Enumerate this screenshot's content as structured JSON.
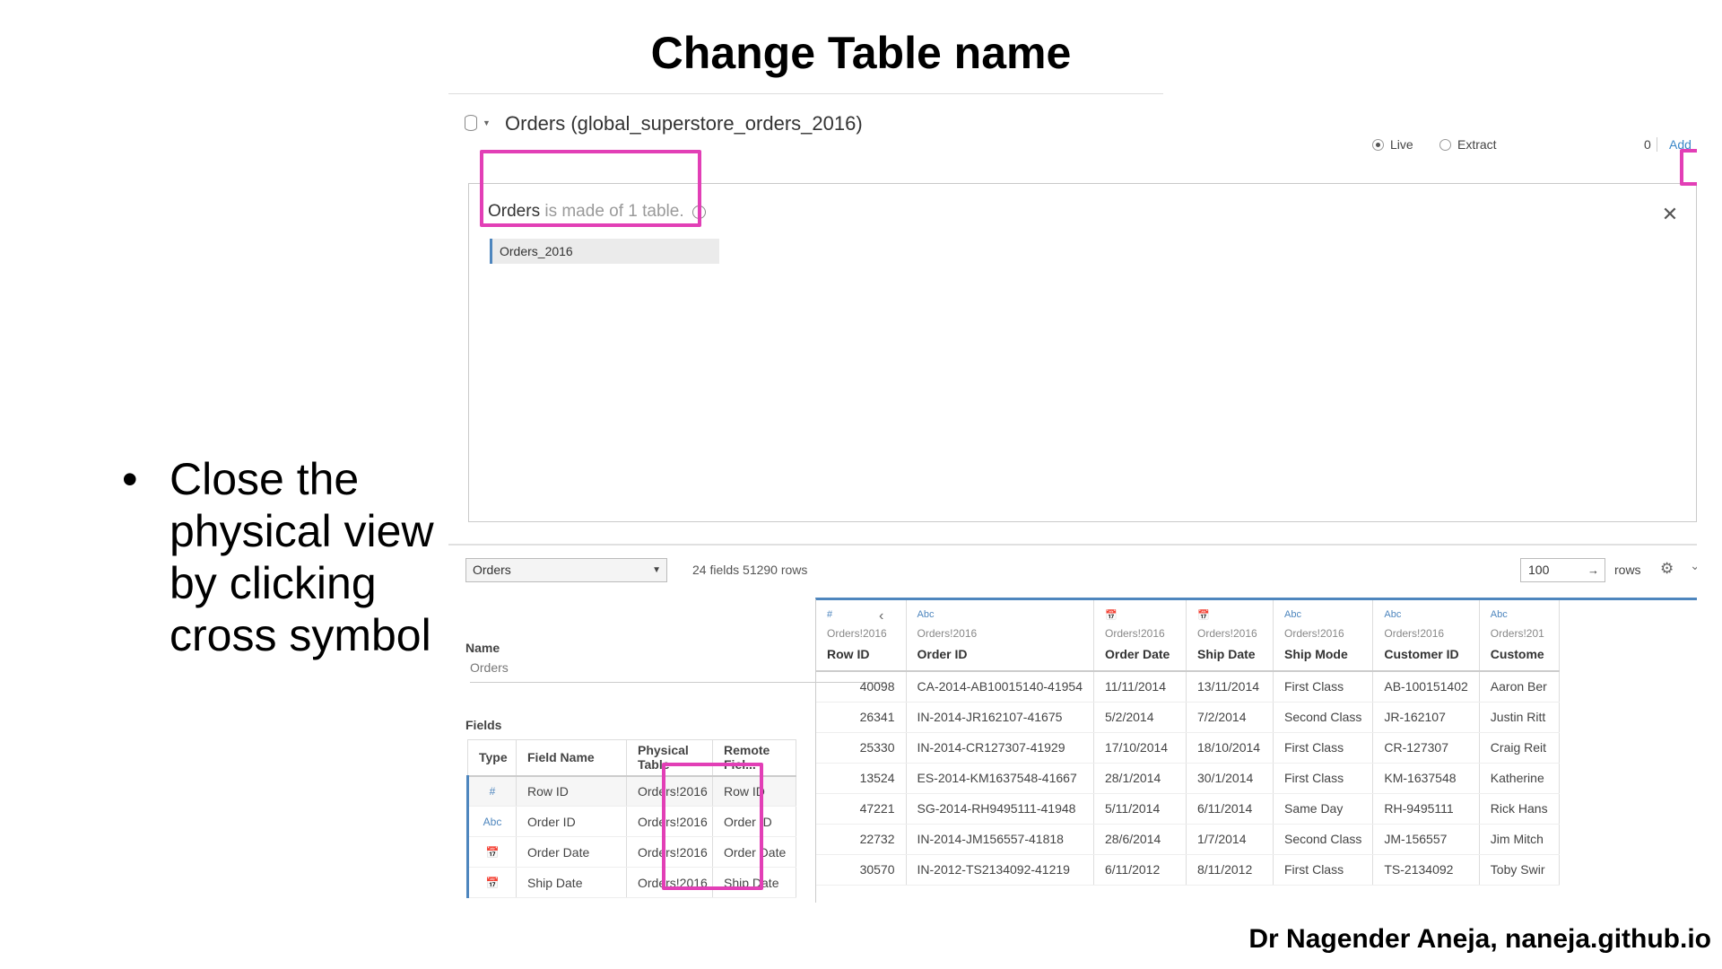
{
  "slide": {
    "title": "Change Table name",
    "bullet": "Close the physical view by clicking cross symbol",
    "footer": "Dr Nagender Aneja, naneja.github.io"
  },
  "datasource": {
    "title": "Orders (global_superstore_orders_2016)",
    "connection": {
      "live": "Live",
      "extract": "Extract",
      "selected": "Live"
    },
    "filters": {
      "count": "0",
      "add": "Add"
    }
  },
  "physical_view": {
    "relation_name": "Orders",
    "made_of": "is made of 1 table.",
    "table": "Orders_2016"
  },
  "toolbar": {
    "table_select": "Orders",
    "fields_rows": "24 fields 51290 rows",
    "rows_value": "100",
    "rows_label": "rows"
  },
  "details": {
    "name_label": "Name",
    "name_value": "Orders",
    "fields_label": "Fields",
    "columns": [
      "Type",
      "Field Name",
      "Physical Table",
      "Remote Fiel..."
    ],
    "rows": [
      {
        "type": "#",
        "field": "Row ID",
        "physical": "Orders!2016",
        "remote": "Row ID"
      },
      {
        "type": "Abc",
        "field": "Order ID",
        "physical": "Orders!2016",
        "remote": "Order ID"
      },
      {
        "type": "📅",
        "field": "Order Date",
        "physical": "Orders!2016",
        "remote": "Order Date"
      },
      {
        "type": "📅",
        "field": "Ship Date",
        "physical": "Orders!2016",
        "remote": "Ship Date"
      }
    ]
  },
  "grid": {
    "columns": [
      {
        "type": "#",
        "source": "Orders!2016",
        "name": "Row ID"
      },
      {
        "type": "Abc",
        "source": "Orders!2016",
        "name": "Order ID"
      },
      {
        "type": "📅",
        "source": "Orders!2016",
        "name": "Order Date"
      },
      {
        "type": "📅",
        "source": "Orders!2016",
        "name": "Ship Date"
      },
      {
        "type": "Abc",
        "source": "Orders!2016",
        "name": "Ship Mode"
      },
      {
        "type": "Abc",
        "source": "Orders!2016",
        "name": "Customer ID"
      },
      {
        "type": "Abc",
        "source": "Orders!201",
        "name": "Custome"
      }
    ],
    "rows": [
      [
        "40098",
        "CA-2014-AB10015140-41954",
        "11/11/2014",
        "13/11/2014",
        "First Class",
        "AB-100151402",
        "Aaron Ber"
      ],
      [
        "26341",
        "IN-2014-JR162107-41675",
        "5/2/2014",
        "7/2/2014",
        "Second Class",
        "JR-162107",
        "Justin Ritt"
      ],
      [
        "25330",
        "IN-2014-CR127307-41929",
        "17/10/2014",
        "18/10/2014",
        "First Class",
        "CR-127307",
        "Craig Reit"
      ],
      [
        "13524",
        "ES-2014-KM1637548-41667",
        "28/1/2014",
        "30/1/2014",
        "First Class",
        "KM-1637548",
        "Katherine"
      ],
      [
        "47221",
        "SG-2014-RH9495111-41948",
        "5/11/2014",
        "6/11/2014",
        "Same Day",
        "RH-9495111",
        "Rick Hans"
      ],
      [
        "22732",
        "IN-2014-JM156557-41818",
        "28/6/2014",
        "1/7/2014",
        "Second Class",
        "JM-156557",
        "Jim Mitch"
      ],
      [
        "30570",
        "IN-2012-TS2134092-41219",
        "6/11/2012",
        "8/11/2012",
        "First Class",
        "TS-2134092",
        "Toby Swir"
      ]
    ]
  },
  "colors": {
    "highlight": "#e23fb6",
    "accent": "#4e86be"
  }
}
